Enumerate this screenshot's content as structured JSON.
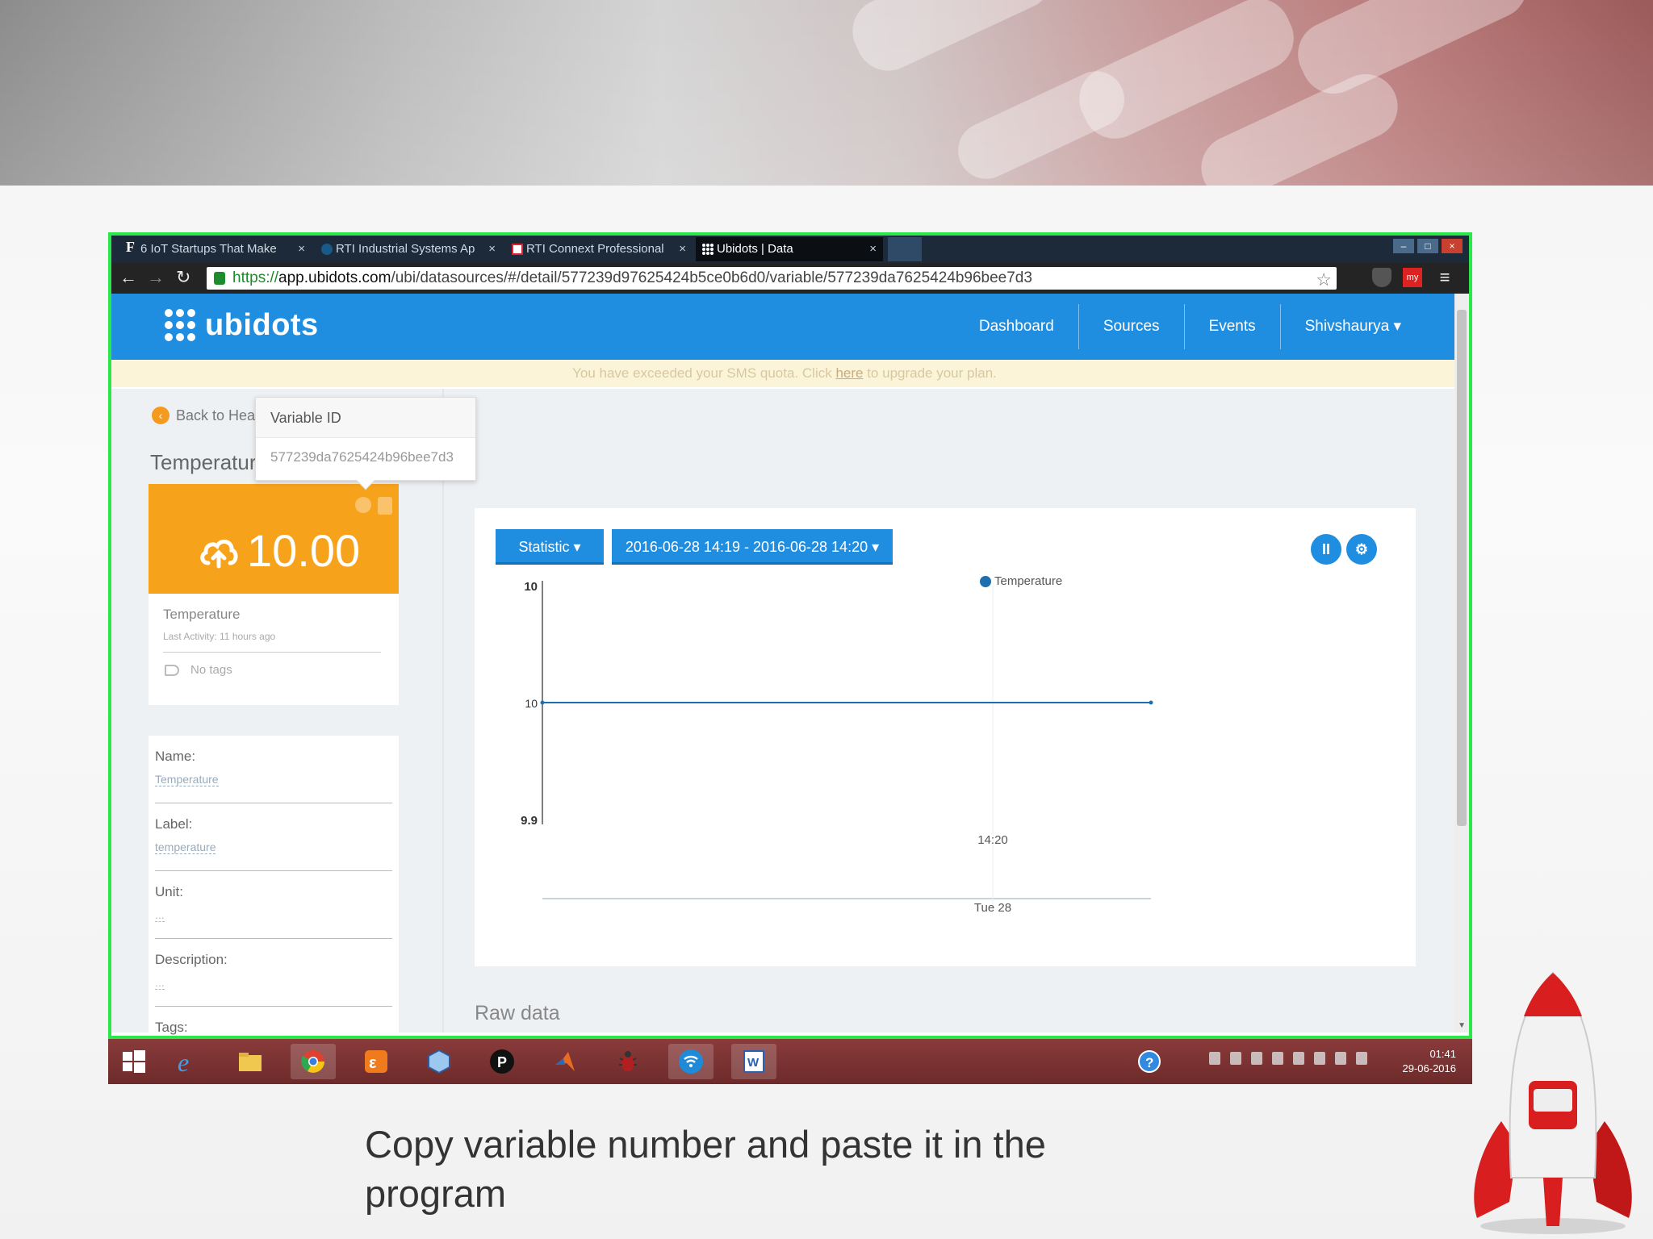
{
  "browser": {
    "tabs": [
      {
        "label": "6 IoT Startups That Make",
        "close": "×",
        "icon": "forbes-f-icon"
      },
      {
        "label": "RTI Industrial Systems Ap",
        "close": "×",
        "icon": "rti-icon"
      },
      {
        "label": "RTI Connext Professional",
        "close": "×",
        "icon": "gmail-icon"
      },
      {
        "label": "Ubidots | Data",
        "close": "×",
        "icon": "ubidots-icon"
      }
    ],
    "url_scheme": "https://",
    "url_domain": "app.ubidots.com",
    "url_path": "/ubi/datasources/#/detail/577239d97625424b5ce0b6d0/variable/577239da7625424b96bee7d3"
  },
  "app": {
    "logo": "ubidots",
    "nav": [
      "Dashboard",
      "Sources",
      "Events",
      "Shivshaurya ▾"
    ],
    "warning_pre": "You have exceeded your SMS quota. Click ",
    "warning_link": "here",
    "warning_post": " to upgrade your plan.",
    "back_label": "Back to Healt",
    "variable_title": "Temperatur",
    "tooltip": {
      "title": "Variable ID",
      "value": "577239da7625424b96bee7d3"
    },
    "value_card": {
      "value": "10.00",
      "color": "#f7a21b"
    },
    "info": {
      "name": "Temperature",
      "last_activity": "Last Activity: 11 hours ago",
      "tags": "No tags"
    },
    "properties": [
      {
        "label": "Name:",
        "value": "Temperature"
      },
      {
        "label": "Label:",
        "value": "temperature"
      },
      {
        "label": "Unit:",
        "value": "..."
      },
      {
        "label": "Description:",
        "value": "..."
      }
    ],
    "tags_label": "Tags:",
    "statistic_button": "Statistic ▾",
    "date_range_button": "2016-06-28 14:19 - 2016-06-28 14:20 ▾",
    "raw_data": "Raw data",
    "accent": "#1f8ee0"
  },
  "chart_data": {
    "type": "line",
    "series": [
      {
        "name": "Temperature",
        "x": [
          "14:19",
          "14:20"
        ],
        "values": [
          10,
          10
        ]
      }
    ],
    "y_ticks": [
      "10",
      "10",
      "9.9"
    ],
    "x_tick": "14:20",
    "x_secondary": "Tue 28"
  },
  "taskbar": {
    "icons": [
      "windows-start-icon",
      "internet-explorer-icon",
      "file-explorer-icon",
      "chrome-icon",
      "xampp-icon",
      "virtualbox-icon",
      "pycharm-icon",
      "matlab-icon",
      "bug-icon",
      "wifi-app-icon",
      "word-icon"
    ],
    "time": "01:41",
    "date": "29-06-2016"
  },
  "caption": "Copy variable number and paste it in the program"
}
